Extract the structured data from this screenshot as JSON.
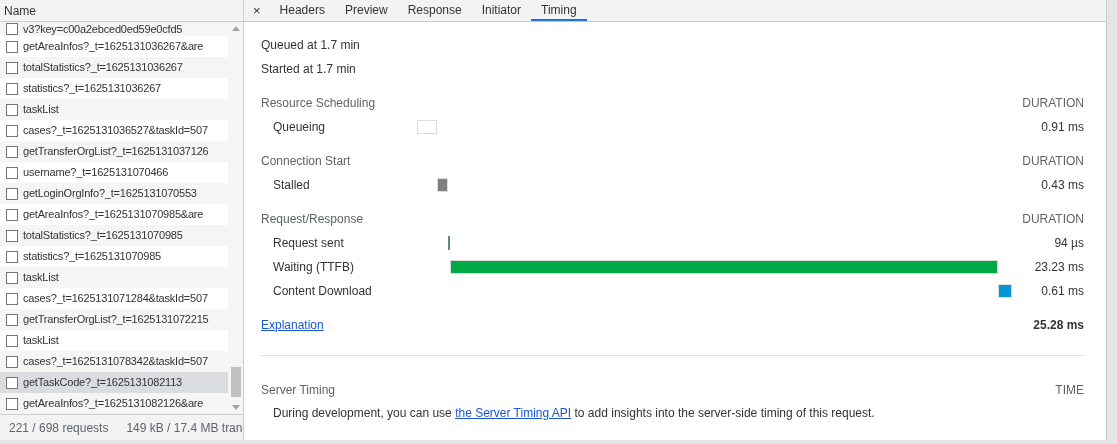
{
  "requests": {
    "column_header": "Name",
    "rows": [
      {
        "name": "v3?key=c00a2ebced0ed59e0cfd5",
        "selected": false
      },
      {
        "name": "getAreaInfos?_t=1625131036267&are",
        "selected": false
      },
      {
        "name": "totalStatistics?_t=1625131036267",
        "selected": false
      },
      {
        "name": "statistics?_t=1625131036267",
        "selected": false
      },
      {
        "name": "taskList",
        "selected": false
      },
      {
        "name": "cases?_t=1625131036527&taskId=507",
        "selected": false
      },
      {
        "name": "getTransferOrgList?_t=1625131037126",
        "selected": false
      },
      {
        "name": "username?_t=1625131070466",
        "selected": false
      },
      {
        "name": "getLoginOrgInfo?_t=1625131070553",
        "selected": false
      },
      {
        "name": "getAreaInfos?_t=1625131070985&are",
        "selected": false
      },
      {
        "name": "totalStatistics?_t=1625131070985",
        "selected": false
      },
      {
        "name": "statistics?_t=1625131070985",
        "selected": false
      },
      {
        "name": "taskList",
        "selected": false
      },
      {
        "name": "cases?_t=1625131071284&taskId=507",
        "selected": false
      },
      {
        "name": "getTransferOrgList?_t=1625131072215",
        "selected": false
      },
      {
        "name": "taskList",
        "selected": false
      },
      {
        "name": "cases?_t=1625131078342&taskId=507",
        "selected": false
      },
      {
        "name": "getTaskCode?_t=1625131082113",
        "selected": true
      },
      {
        "name": "getAreaInfos?_t=1625131082126&are",
        "selected": false
      }
    ],
    "status": [
      "221 / 698 requests",
      "149 kB / 17.4 MB tran"
    ]
  },
  "close": "×",
  "tabs": [
    {
      "label": "Headers",
      "selected": false
    },
    {
      "label": "Preview",
      "selected": false
    },
    {
      "label": "Response",
      "selected": false
    },
    {
      "label": "Initiator",
      "selected": false
    },
    {
      "label": "Timing",
      "selected": true
    }
  ],
  "queued": "Queued at 1.7 min",
  "started": "Started at 1.7 min",
  "sections": [
    {
      "title": "Resource Scheduling",
      "column": "DURATION",
      "phases": [
        {
          "label": "Queueing",
          "color": "#ffffff",
          "duration": "0.91 ms"
        }
      ]
    },
    {
      "title": "Connection Start",
      "column": "DURATION",
      "phases": [
        {
          "label": "Stalled",
          "color": "#808080",
          "duration": "0.43 ms"
        }
      ]
    },
    {
      "title": "Request/Response",
      "column": "DURATION",
      "phases": [
        {
          "label": "Request sent",
          "color": "#5f8a8b",
          "duration": "94 µs"
        },
        {
          "label": "Waiting (TTFB)",
          "color": "#00a846",
          "duration": "23.23 ms"
        },
        {
          "label": "Content Download",
          "color": "#0695d6",
          "duration": "0.61 ms"
        }
      ]
    }
  ],
  "explanation": "Explanation",
  "total": "25.28 ms",
  "server_timing": {
    "title": "Server Timing",
    "column": "TIME",
    "text_before": "During development, you can use",
    "link": "the Server Timing API",
    "text_after": "to add insights into the server-side timing of this request."
  }
}
